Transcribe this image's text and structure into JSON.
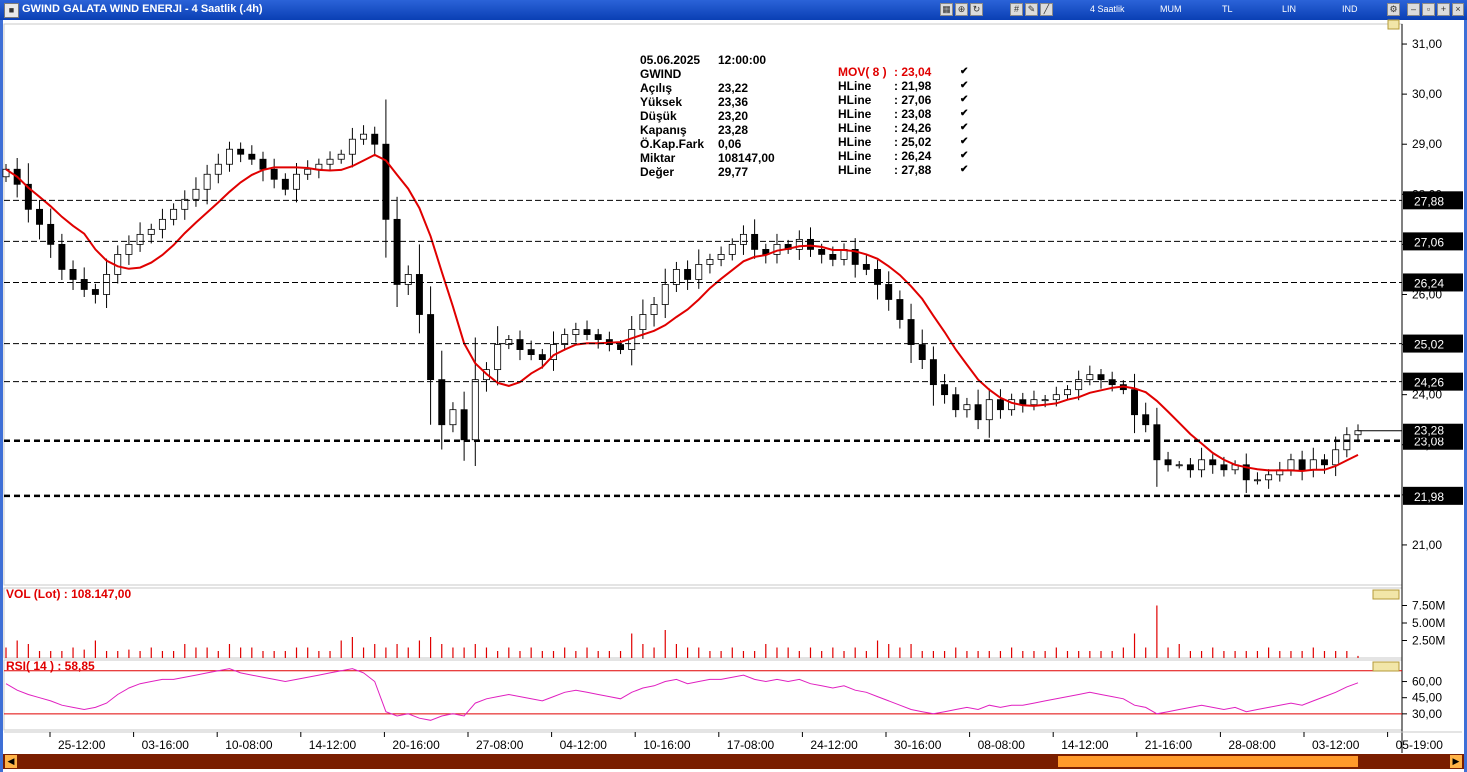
{
  "window": {
    "title": "GWIND GALATA WIND ENERJI - 4 Saatlik (.4h)",
    "menu": [
      "4 Saatlik",
      "MUM",
      "TL",
      "LIN",
      "IND"
    ]
  },
  "info_panel": {
    "rows": [
      {
        "label": "05.06.2025",
        "value": "12:00:00"
      },
      {
        "label": "GWIND",
        "value": ""
      },
      {
        "label": "Açılış",
        "value": "23,22"
      },
      {
        "label": "Yüksek",
        "value": "23,36"
      },
      {
        "label": "Düşük",
        "value": "23,20"
      },
      {
        "label": "Kapanış",
        "value": "23,28"
      },
      {
        "label": "Ö.Kap.Fark",
        "value": "0,06"
      },
      {
        "label": "Miktar",
        "value": "108147,00"
      },
      {
        "label": "Değer",
        "value": "29,77"
      }
    ],
    "indicators": [
      {
        "label": "MOV( 8 )",
        "value": ": 23,04",
        "color": "#e00000"
      },
      {
        "label": "HLine",
        "value": ": 21,98",
        "color": "#000000"
      },
      {
        "label": "HLine",
        "value": ": 27,06",
        "color": "#000000"
      },
      {
        "label": "HLine",
        "value": ": 23,08",
        "color": "#000000"
      },
      {
        "label": "HLine",
        "value": ": 24,26",
        "color": "#000000"
      },
      {
        "label": "HLine",
        "value": ": 25,02",
        "color": "#000000"
      },
      {
        "label": "HLine",
        "value": ": 26,24",
        "color": "#000000"
      },
      {
        "label": "HLine",
        "value": ": 27,88",
        "color": "#000000"
      }
    ]
  },
  "volume_panel": {
    "label": "VOL (Lot)   : 108.147,00"
  },
  "rsi_panel": {
    "label": "RSI( 14 )    : 58,85"
  },
  "chart_data": [
    {
      "type": "candlestick",
      "ylim": [
        20.2,
        31.4
      ],
      "y_ticks": [
        "31,00",
        "30,00",
        "29,00",
        "28,00",
        "27,00",
        "26,00",
        "25,00",
        "24,00",
        "23,00",
        "22,00",
        "21,00"
      ],
      "x_ticks": [
        "25-12:00",
        "03-16:00",
        "10-08:00",
        "14-12:00",
        "20-16:00",
        "27-08:00",
        "04-12:00",
        "10-16:00",
        "17-08:00",
        "24-12:00",
        "30-16:00",
        "08-08:00",
        "14-12:00",
        "21-16:00",
        "28-08:00",
        "03-12:00",
        "05-19:00"
      ],
      "hlines": [
        {
          "value": 27.88,
          "label": "27,88"
        },
        {
          "value": 27.06,
          "label": "27,06"
        },
        {
          "value": 26.24,
          "label": "26,24"
        },
        {
          "value": 25.02,
          "label": "25,02"
        },
        {
          "value": 24.26,
          "label": "24,26"
        },
        {
          "value": 23.08,
          "label": "23,08",
          "bold": true
        },
        {
          "value": 21.98,
          "label": "21,98",
          "bold": true
        }
      ],
      "last_price_label": "23,28",
      "last_price": 23.28,
      "closes": [
        28.5,
        28.2,
        27.7,
        27.4,
        27.0,
        26.5,
        26.3,
        26.1,
        26.0,
        26.4,
        26.8,
        27.0,
        27.2,
        27.3,
        27.5,
        27.7,
        27.9,
        28.1,
        28.4,
        28.6,
        28.9,
        28.8,
        28.7,
        28.5,
        28.3,
        28.1,
        28.4,
        28.5,
        28.6,
        28.7,
        28.8,
        29.1,
        29.2,
        29.0,
        27.5,
        26.2,
        26.4,
        25.6,
        24.3,
        23.4,
        23.7,
        23.1,
        24.3,
        24.5,
        25.0,
        25.1,
        24.9,
        24.8,
        24.7,
        25.0,
        25.2,
        25.3,
        25.2,
        25.1,
        25.0,
        24.9,
        25.3,
        25.6,
        25.8,
        26.2,
        26.5,
        26.3,
        26.6,
        26.7,
        26.8,
        27.0,
        27.2,
        26.9,
        26.8,
        27.0,
        26.9,
        27.1,
        26.9,
        26.8,
        26.7,
        26.9,
        26.6,
        26.5,
        26.2,
        25.9,
        25.5,
        25.0,
        24.7,
        24.2,
        24.0,
        23.7,
        23.8,
        23.5,
        23.9,
        23.7,
        23.9,
        23.8,
        23.9,
        23.9,
        24.0,
        24.1,
        24.3,
        24.4,
        24.3,
        24.2,
        24.1,
        23.6,
        23.4,
        22.7,
        22.6,
        22.6,
        22.5,
        22.7,
        22.6,
        22.5,
        22.6,
        22.3,
        22.3,
        22.4,
        22.5,
        22.7,
        22.5,
        22.7,
        22.6,
        22.9,
        23.2,
        23.28
      ],
      "volume_ylim": [
        0,
        10000000
      ],
      "volume_ticks": [
        "7.50M",
        "5.00M",
        "2.50M"
      ],
      "volumes": [
        1.5,
        2.5,
        2.0,
        1.0,
        1.0,
        1.0,
        1.5,
        1.2,
        2.5,
        1.0,
        1.0,
        1.2,
        1.0,
        1.5,
        1.0,
        1.0,
        2.0,
        1.5,
        1.5,
        1.0,
        2.0,
        1.5,
        1.5,
        1.0,
        1.0,
        1.0,
        1.5,
        1.5,
        1.0,
        1.0,
        2.5,
        3.0,
        1.5,
        2.0,
        1.5,
        2.0,
        1.5,
        2.5,
        3.0,
        2.0,
        1.5,
        1.5,
        2.0,
        1.5,
        1.0,
        1.5,
        1.0,
        1.5,
        1.0,
        1.0,
        1.5,
        1.0,
        1.5,
        1.0,
        1.0,
        1.0,
        3.5,
        2.0,
        1.5,
        4.0,
        2.0,
        1.5,
        1.5,
        1.0,
        1.0,
        1.5,
        1.0,
        1.0,
        2.0,
        1.5,
        1.5,
        1.0,
        1.5,
        1.0,
        1.5,
        1.0,
        1.5,
        1.0,
        2.5,
        2.0,
        1.5,
        2.0,
        1.0,
        1.0,
        1.0,
        1.5,
        1.0,
        1.0,
        1.0,
        1.0,
        1.5,
        1.0,
        1.0,
        1.0,
        1.5,
        1.0,
        1.0,
        1.0,
        1.0,
        1.0,
        1.5,
        3.5,
        1.5,
        7.5,
        1.5,
        2.0,
        1.0,
        1.0,
        1.5,
        1.0,
        1.0,
        1.0,
        1.0,
        1.5,
        1.0,
        1.0,
        1.0,
        1.5,
        1.0,
        1.0,
        1.0,
        0.3
      ],
      "rsi_ylim": [
        15,
        80
      ],
      "rsi_ticks": [
        "60,00",
        "45,00",
        "30,00"
      ],
      "rsi_lines": [
        70,
        30
      ],
      "rsi": [
        58,
        52,
        48,
        45,
        42,
        38,
        36,
        34,
        36,
        40,
        48,
        54,
        58,
        60,
        62,
        62,
        64,
        66,
        68,
        70,
        72,
        68,
        66,
        64,
        62,
        60,
        62,
        64,
        66,
        68,
        70,
        72,
        68,
        60,
        32,
        28,
        30,
        26,
        24,
        28,
        30,
        28,
        40,
        44,
        46,
        48,
        46,
        44,
        42,
        46,
        50,
        52,
        50,
        48,
        46,
        44,
        50,
        54,
        56,
        60,
        62,
        58,
        60,
        62,
        62,
        64,
        66,
        62,
        60,
        62,
        60,
        62,
        58,
        56,
        54,
        56,
        52,
        50,
        46,
        42,
        38,
        34,
        32,
        30,
        32,
        34,
        36,
        34,
        38,
        36,
        38,
        38,
        40,
        42,
        44,
        46,
        48,
        50,
        48,
        46,
        44,
        38,
        36,
        30,
        32,
        34,
        36,
        38,
        36,
        34,
        36,
        32,
        34,
        36,
        38,
        40,
        38,
        42,
        46,
        50,
        55,
        58.85
      ]
    }
  ]
}
